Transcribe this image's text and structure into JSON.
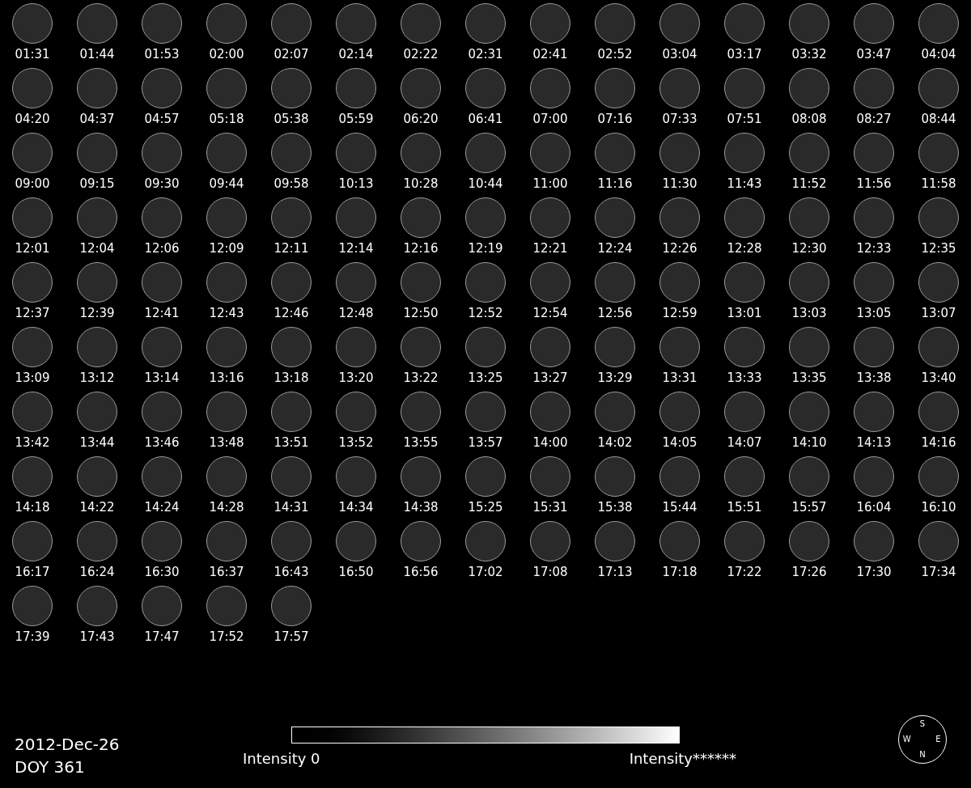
{
  "thumbnails": [
    "01:31",
    "01:44",
    "01:53",
    "02:00",
    "02:07",
    "02:14",
    "02:22",
    "02:31",
    "02:41",
    "02:52",
    "03:04",
    "03:17",
    "03:32",
    "03:47",
    "04:04",
    "04:20",
    "04:37",
    "04:57",
    "05:18",
    "05:38",
    "05:59",
    "06:20",
    "06:41",
    "07:00",
    "07:16",
    "07:33",
    "07:51",
    "08:08",
    "08:27",
    "08:44",
    "09:00",
    "09:15",
    "09:30",
    "09:44",
    "09:58",
    "10:13",
    "10:28",
    "10:44",
    "11:00",
    "11:16",
    "11:30",
    "11:43",
    "11:52",
    "11:56",
    "11:58",
    "12:01",
    "12:04",
    "12:06",
    "12:09",
    "12:11",
    "12:14",
    "12:16",
    "12:19",
    "12:21",
    "12:24",
    "12:26",
    "12:28",
    "12:30",
    "12:33",
    "12:35",
    "12:37",
    "12:39",
    "12:41",
    "12:43",
    "12:46",
    "12:48",
    "12:50",
    "12:52",
    "12:54",
    "12:56",
    "12:59",
    "13:01",
    "13:03",
    "13:05",
    "13:07",
    "13:09",
    "13:12",
    "13:14",
    "13:16",
    "13:18",
    "13:20",
    "13:22",
    "13:25",
    "13:27",
    "13:29",
    "13:31",
    "13:33",
    "13:35",
    "13:38",
    "13:40",
    "13:42",
    "13:44",
    "13:46",
    "13:48",
    "13:51",
    "13:52",
    "13:55",
    "13:57",
    "14:00",
    "14:02",
    "14:05",
    "14:07",
    "14:10",
    "14:13",
    "14:16",
    "14:18",
    "14:22",
    "14:24",
    "14:28",
    "14:31",
    "14:34",
    "14:38",
    "15:25",
    "15:31",
    "15:38",
    "15:44",
    "15:51",
    "15:57",
    "16:04",
    "16:10",
    "16:17",
    "16:24",
    "16:30",
    "16:37",
    "16:43",
    "16:50",
    "16:56",
    "17:02",
    "17:08",
    "17:13",
    "17:18",
    "17:22",
    "17:26",
    "17:30",
    "17:34",
    "17:39",
    "17:43",
    "17:47",
    "17:52",
    "17:57"
  ],
  "date": "2012-Dec-26",
  "doy": "DOY 361",
  "colorbar": {
    "min_label": "Intensity 0",
    "max_label": "Intensity******"
  },
  "compass": {
    "top": "S",
    "left": "W",
    "right": "E",
    "bottom": "N"
  }
}
